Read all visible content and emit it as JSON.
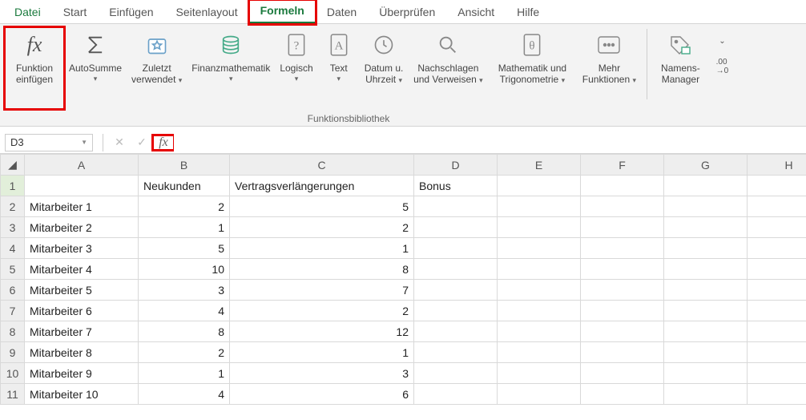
{
  "tabs": {
    "file": "Datei",
    "home": "Start",
    "insert": "Einfügen",
    "layout": "Seitenlayout",
    "formulas": "Formeln",
    "data": "Daten",
    "review": "Überprüfen",
    "view": "Ansicht",
    "help": "Hilfe"
  },
  "ribbon": {
    "insertFunction": {
      "l1": "Funktion",
      "l2": "einfügen"
    },
    "autosum": {
      "l1": "AutoSumme"
    },
    "recent": {
      "l1": "Zuletzt",
      "l2": "verwendet"
    },
    "financial": {
      "l1": "Finanzmathematik"
    },
    "logical": {
      "l1": "Logisch"
    },
    "text": {
      "l1": "Text"
    },
    "datetime": {
      "l1": "Datum u.",
      "l2": "Uhrzeit"
    },
    "lookup": {
      "l1": "Nachschlagen",
      "l2": "und Verweisen"
    },
    "math": {
      "l1": "Mathematik und",
      "l2": "Trigonometrie"
    },
    "more": {
      "l1": "Mehr",
      "l2": "Funktionen"
    },
    "names": {
      "l1": "Namens-",
      "l2": "Manager"
    },
    "groupLabel": "Funktionsbibliothek"
  },
  "formulaBar": {
    "nameBox": "D3"
  },
  "grid": {
    "columns": [
      "A",
      "B",
      "C",
      "D",
      "E",
      "F",
      "G",
      "H"
    ],
    "rowNumbers": [
      "1",
      "2",
      "3",
      "4",
      "5",
      "6",
      "7",
      "8",
      "9",
      "10",
      "11"
    ],
    "headers": {
      "b": "Neukunden",
      "c": "Vertragsverlängerungen",
      "d": "Bonus"
    },
    "rows": [
      {
        "a": "Mitarbeiter 1",
        "b": "2",
        "c": "5"
      },
      {
        "a": "Mitarbeiter 2",
        "b": "1",
        "c": "2"
      },
      {
        "a": "Mitarbeiter 3",
        "b": "5",
        "c": "1"
      },
      {
        "a": "Mitarbeiter 4",
        "b": "10",
        "c": "8"
      },
      {
        "a": "Mitarbeiter 5",
        "b": "3",
        "c": "7"
      },
      {
        "a": "Mitarbeiter 6",
        "b": "4",
        "c": "2"
      },
      {
        "a": "Mitarbeiter 7",
        "b": "8",
        "c": "12"
      },
      {
        "a": "Mitarbeiter 8",
        "b": "2",
        "c": "1"
      },
      {
        "a": "Mitarbeiter 9",
        "b": "1",
        "c": "3"
      },
      {
        "a": "Mitarbeiter 10",
        "b": "4",
        "c": "6"
      }
    ]
  }
}
